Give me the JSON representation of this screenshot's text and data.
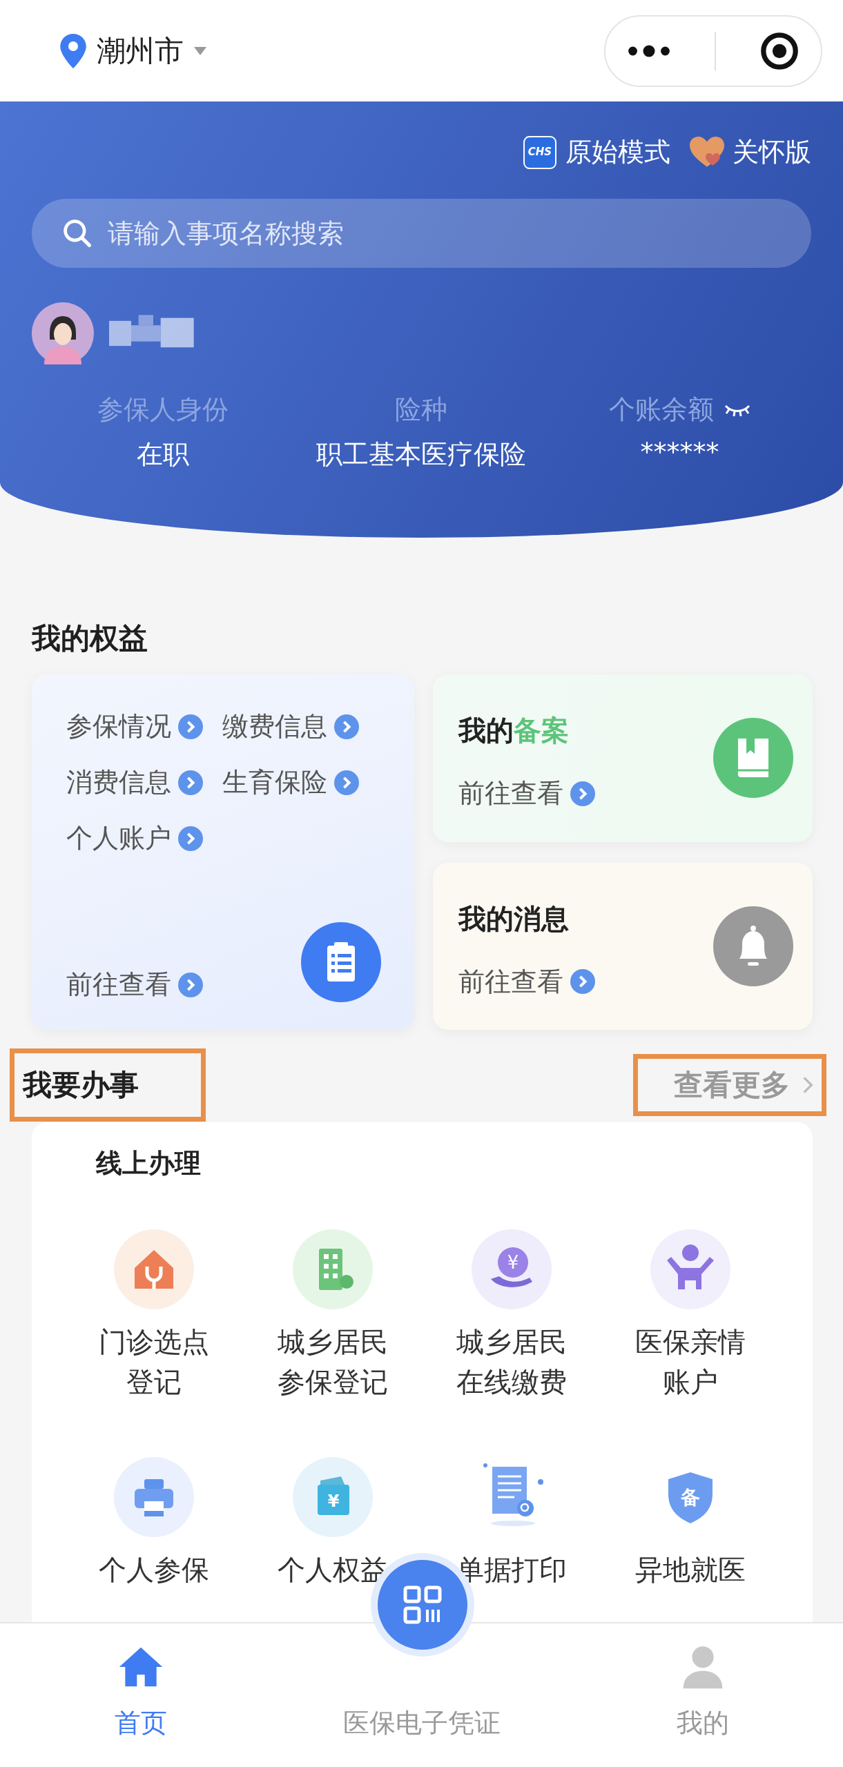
{
  "header": {
    "city": "潮州市"
  },
  "banner": {
    "modes": [
      {
        "kind": "logo",
        "logo_text": "CHS",
        "label": "原始模式"
      },
      {
        "kind": "heart",
        "label": "关怀版"
      }
    ],
    "search": {
      "placeholder": "请输入事项名称搜索"
    },
    "stats": [
      {
        "label": "参保人身份",
        "value": "在职"
      },
      {
        "label": "险种",
        "value": "职工基本医疗保险"
      },
      {
        "label": "个账余额",
        "value": "******",
        "masked": true
      }
    ]
  },
  "benefits": {
    "title": "我的权益",
    "links": [
      "参保情况",
      "缴费信息",
      "消费信息",
      "生育保险",
      "个人账户"
    ],
    "more": "前往查看",
    "cards": [
      {
        "title": "我的",
        "highlight": "备案",
        "more": "前往查看",
        "kind": "book"
      },
      {
        "title": "我的消息",
        "more": "前往查看",
        "kind": "bell"
      }
    ]
  },
  "services": {
    "title": "我要办事",
    "title_highlighted": true,
    "more": "查看更多",
    "more_highlighted": true,
    "group_title": "线上办理",
    "items": [
      {
        "lines": [
          "门诊选点",
          "登记"
        ],
        "kind": "clinic"
      },
      {
        "lines": [
          "城乡居民",
          "参保登记"
        ],
        "kind": "building"
      },
      {
        "lines": [
          "城乡居民",
          "在线缴费"
        ],
        "kind": "coin",
        "glyph": "¥"
      },
      {
        "lines": [
          "医保亲情",
          "账户"
        ],
        "kind": "child"
      },
      {
        "lines": [
          "个人参保"
        ],
        "kind": "printer"
      },
      {
        "lines": [
          "个人权益"
        ],
        "kind": "wallet",
        "glyph": "¥"
      },
      {
        "lines": [
          "单据打印"
        ],
        "kind": "document"
      },
      {
        "lines": [
          "异地就医"
        ],
        "kind": "shield",
        "glyph": "备"
      }
    ]
  },
  "tab_bar": [
    {
      "label": "首页",
      "kind": "home",
      "selected": true
    },
    {
      "label": "医保电子凭证",
      "kind": "qr",
      "selected": false
    },
    {
      "label": "我的",
      "kind": "person",
      "selected": false
    }
  ]
}
